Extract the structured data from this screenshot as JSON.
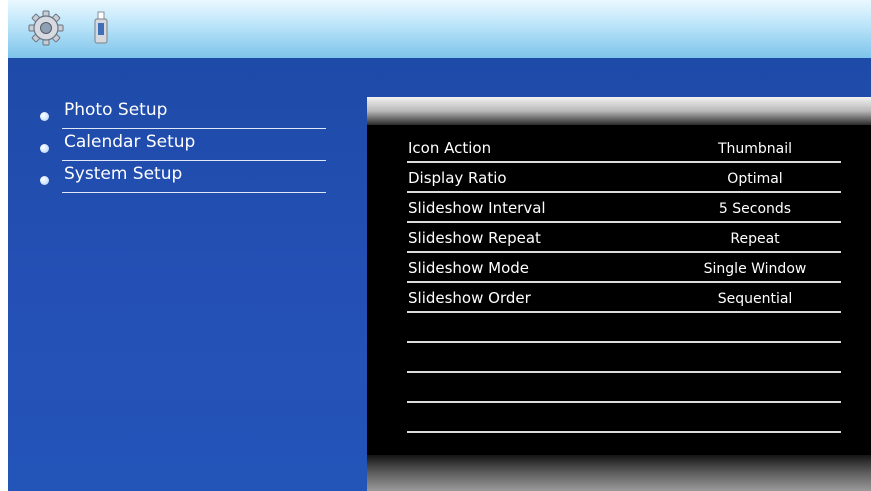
{
  "toolbar": {
    "settings_icon": "gear-icon",
    "device_icon": "usb-drive-icon"
  },
  "menu": {
    "items": [
      {
        "label": "Photo Setup"
      },
      {
        "label": "Calendar Setup"
      },
      {
        "label": "System Setup"
      }
    ]
  },
  "settings": {
    "rows": [
      {
        "name": "Icon Action",
        "value": "Thumbnail"
      },
      {
        "name": "Display Ratio",
        "value": "Optimal"
      },
      {
        "name": "Slideshow Interval",
        "value": "5 Seconds"
      },
      {
        "name": "Slideshow Repeat",
        "value": "Repeat"
      },
      {
        "name": "Slideshow Mode",
        "value": "Single Window"
      },
      {
        "name": "Slideshow Order",
        "value": "Sequential"
      }
    ],
    "empty_row_count": 4
  },
  "colors": {
    "background_blue": "#2450b5",
    "panel_black": "#000000",
    "text": "#ffffff"
  }
}
